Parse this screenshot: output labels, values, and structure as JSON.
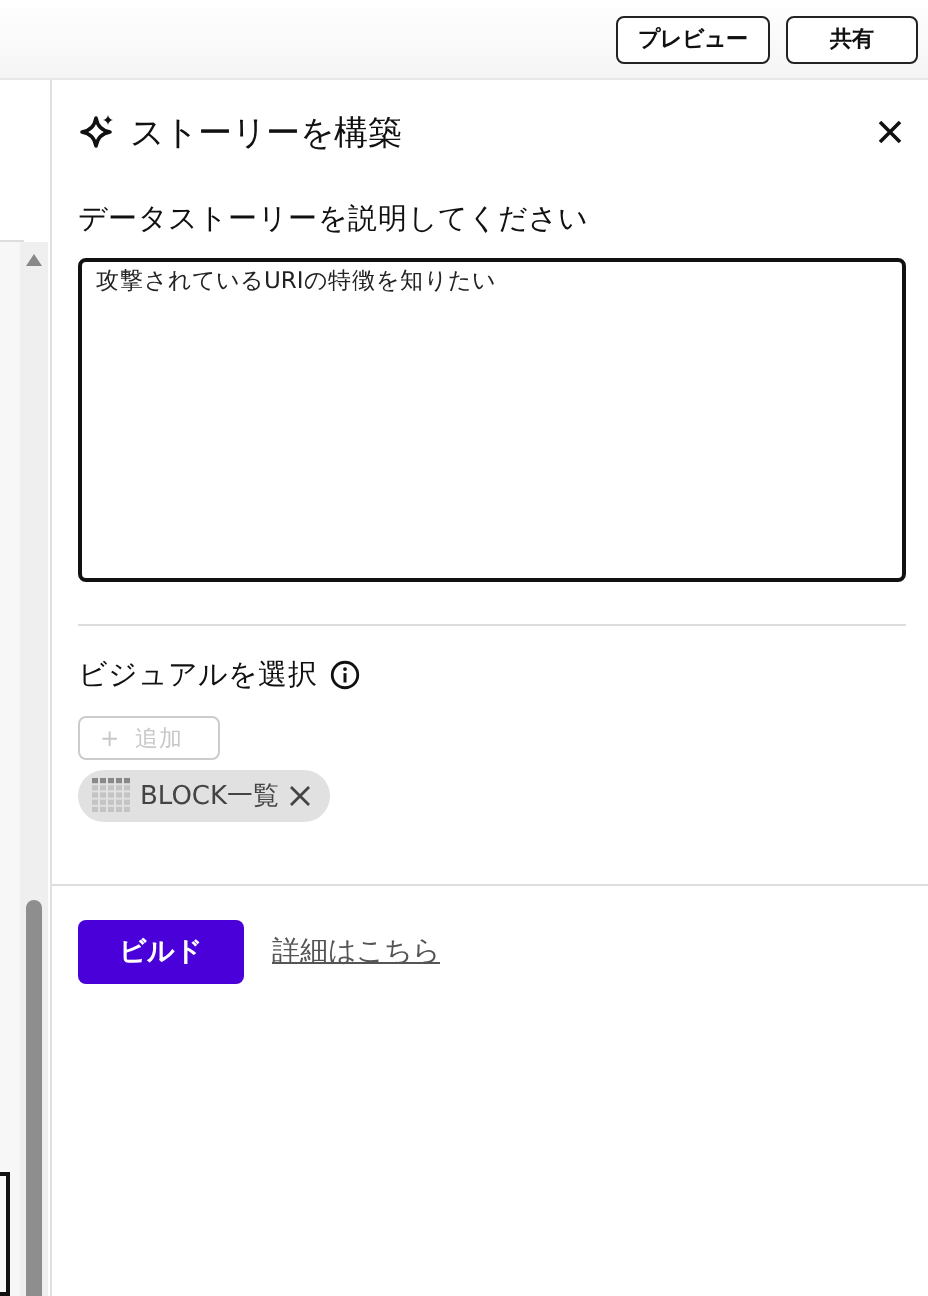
{
  "top_bar": {
    "buttons": [
      "プレビュー",
      "共有"
    ]
  },
  "panel": {
    "title": "ストーリーを構築",
    "description": {
      "label": "データストーリーを説明してください",
      "value": "攻撃されているURIの特徴を知りたい"
    },
    "visuals": {
      "label": "ビジュアルを選択",
      "add_button": {
        "icon": "+",
        "label": "追加",
        "disabled": true
      },
      "chips": [
        {
          "label": "BLOCK一覧"
        }
      ]
    },
    "build_button": "ビルド",
    "learn_more_link": "詳細はこちら"
  }
}
